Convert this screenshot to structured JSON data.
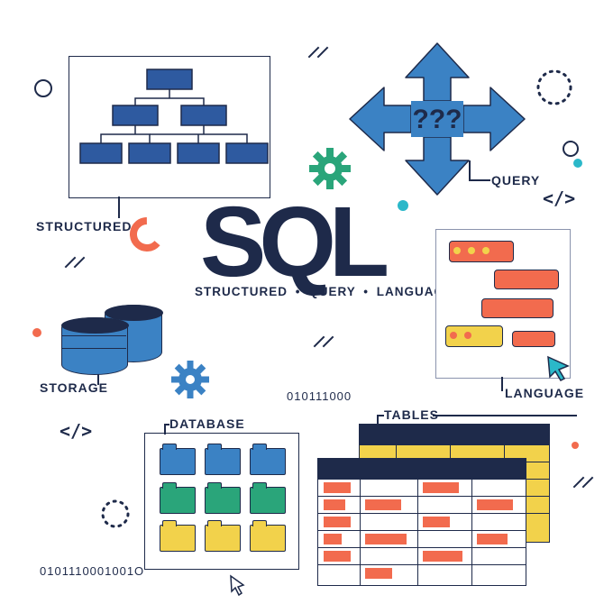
{
  "title": "SQL",
  "subtitle": "STRUCTURED • QUERY • LANGUAGE",
  "labels": {
    "structured": "STRUCTURED",
    "query": "QUERY",
    "storage": "STORAGE",
    "database": "DATABASE",
    "tables": "TABLES",
    "language": "LANGUAGE"
  },
  "query_marks": "???",
  "binary_top": "010111000",
  "binary_bottom": "0101110001001O",
  "colors": {
    "navy": "#1e2a4a",
    "blue": "#3b82c4",
    "green": "#2aa57a",
    "orange": "#f26b4e",
    "yellow": "#f2d24b",
    "cyan": "#2bb8c9"
  }
}
